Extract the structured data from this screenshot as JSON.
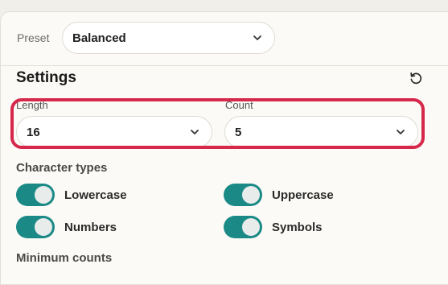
{
  "preset": {
    "label": "Preset",
    "value": "Balanced"
  },
  "settings": {
    "title": "Settings",
    "reset_icon": "reset-icon",
    "length": {
      "label": "Length",
      "value": "16"
    },
    "count": {
      "label": "Count",
      "value": "5"
    },
    "highlight_color": "#d6284a"
  },
  "character_types": {
    "title": "Character types",
    "toggles": [
      {
        "label": "Lowercase",
        "on": true
      },
      {
        "label": "Uppercase",
        "on": true
      },
      {
        "label": "Numbers",
        "on": true
      },
      {
        "label": "Symbols",
        "on": true
      }
    ],
    "toggle_on_color": "#1b8a86"
  },
  "minimum_counts": {
    "title": "Minimum counts"
  }
}
